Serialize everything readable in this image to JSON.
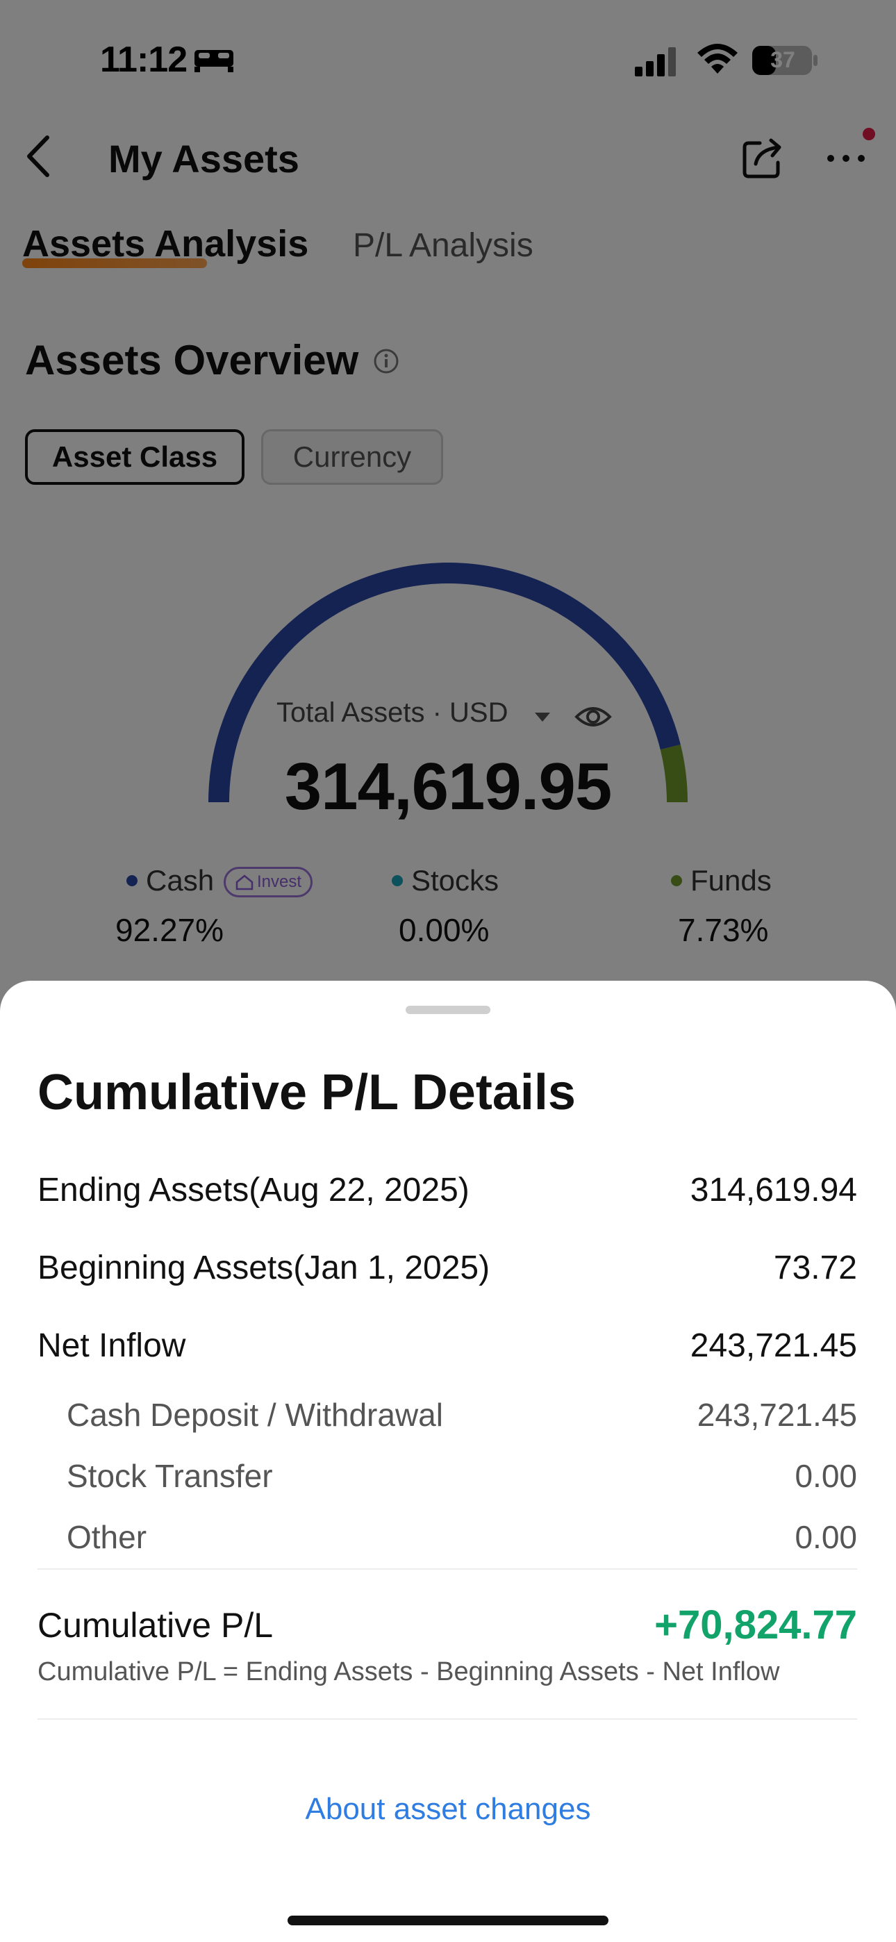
{
  "status_bar": {
    "time": "11:12",
    "battery": "37",
    "icons": [
      "sleep-icon",
      "signal-icon",
      "wifi-icon",
      "battery-icon"
    ]
  },
  "header": {
    "title": "My Assets",
    "icons": [
      "back-icon",
      "share-icon",
      "more-icon"
    ]
  },
  "tabs": [
    {
      "label": "Assets Analysis",
      "active": true
    },
    {
      "label": "P/L Analysis",
      "active": false
    }
  ],
  "overview": {
    "title": "Assets Overview",
    "segments": [
      {
        "label": "Asset Class",
        "active": true
      },
      {
        "label": "Currency",
        "active": false
      }
    ],
    "gauge": {
      "label": "Total Assets",
      "separator": "·",
      "currency": "USD",
      "value": "314,619.95",
      "cash_fraction": 0.9227,
      "funds_fraction": 0.0773,
      "colors": {
        "cash": "#2a47a6",
        "stocks": "#1aa3b8",
        "funds": "#6f9a2a"
      }
    },
    "legend": [
      {
        "name": "Cash",
        "pct": "92.27%",
        "badge": "Invest",
        "color": "#2a47a6"
      },
      {
        "name": "Stocks",
        "pct": "0.00%",
        "color": "#1aa3b8"
      },
      {
        "name": "Funds",
        "pct": "7.73%",
        "color": "#6f9a2a"
      }
    ]
  },
  "sheet": {
    "title": "Cumulative P/L Details",
    "rows": [
      {
        "label": "Ending Assets(Aug 22, 2025)",
        "value": "314,619.94"
      },
      {
        "label": "Beginning Assets(Jan 1, 2025)",
        "value": "73.72"
      },
      {
        "label": "Net Inflow",
        "value": "243,721.45"
      },
      {
        "label": "Cash Deposit / Withdrawal",
        "value": "243,721.45"
      },
      {
        "label": "Stock Transfer",
        "value": "0.00"
      },
      {
        "label": "Other",
        "value": "0.00"
      }
    ],
    "cumulative": {
      "label": "Cumulative P/L",
      "value": "+70,824.77",
      "formula": "Cumulative P/L = Ending Assets - Beginning Assets - Net Inflow",
      "color": "#12a36a"
    },
    "link": "About asset changes"
  }
}
